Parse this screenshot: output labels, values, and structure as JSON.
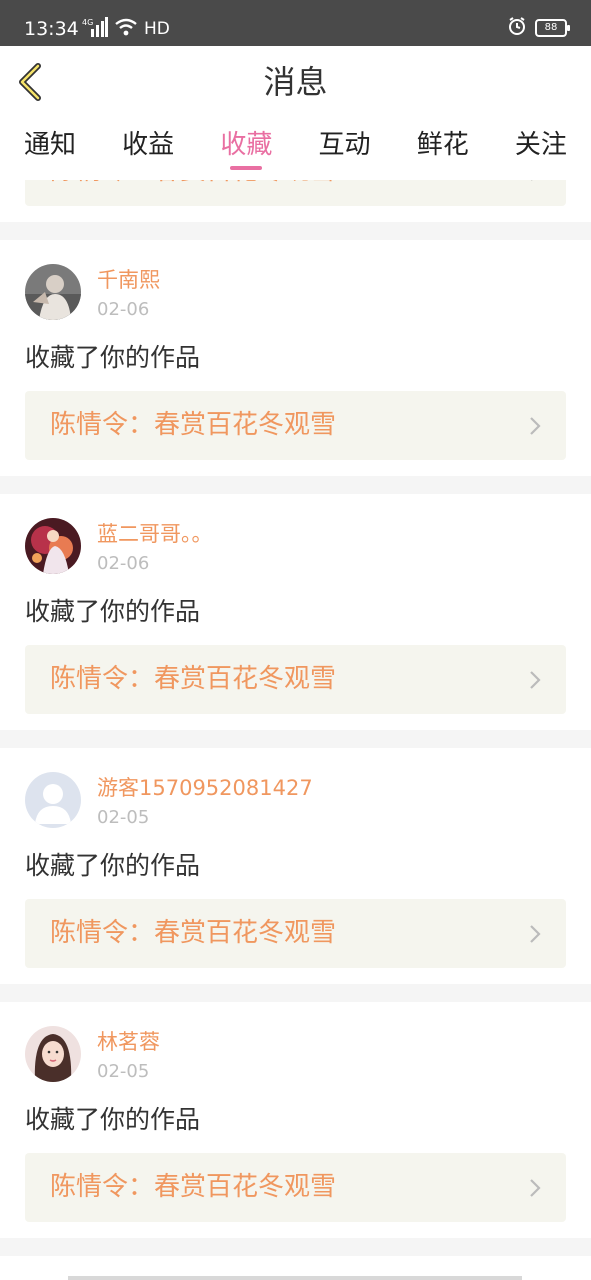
{
  "status_bar": {
    "time": "13:34",
    "network": "4G",
    "hd": "HD",
    "battery": "88",
    "icons": [
      "signal-icon",
      "wifi-icon",
      "alarm-icon",
      "battery-icon"
    ]
  },
  "header": {
    "title": "消息",
    "back_icon": "chevron-left-icon"
  },
  "tabs": [
    {
      "label": "通知",
      "active": false
    },
    {
      "label": "收益",
      "active": false
    },
    {
      "label": "收藏",
      "active": true
    },
    {
      "label": "互动",
      "active": false
    },
    {
      "label": "鲜花",
      "active": false
    },
    {
      "label": "关注",
      "active": false
    }
  ],
  "partial_top": {
    "work_title": "陈情令：春赏百花冬观雪"
  },
  "items": [
    {
      "username": "千南熙",
      "date": "02-06",
      "message": "收藏了你的作品",
      "work_title": "陈情令：春赏百花冬观雪",
      "avatar": "photo-avatar"
    },
    {
      "username": "蓝二哥哥。。",
      "date": "02-06",
      "message": "收藏了你的作品",
      "work_title": "陈情令：春赏百花冬观雪",
      "avatar": "photo-avatar"
    },
    {
      "username": "游客1570952081427",
      "date": "02-05",
      "message": "收藏了你的作品",
      "work_title": "陈情令：春赏百花冬观雪",
      "avatar": "default-user-avatar"
    },
    {
      "username": "林茗蓉",
      "date": "02-05",
      "message": "收藏了你的作品",
      "work_title": "陈情令：春赏百花冬观雪",
      "avatar": "photo-avatar"
    }
  ],
  "colors": {
    "accent_pink": "#e96fa2",
    "username_orange": "#f0975f",
    "card_box_bg": "#f5f5ee",
    "status_bar_bg": "#4a4a4a"
  }
}
